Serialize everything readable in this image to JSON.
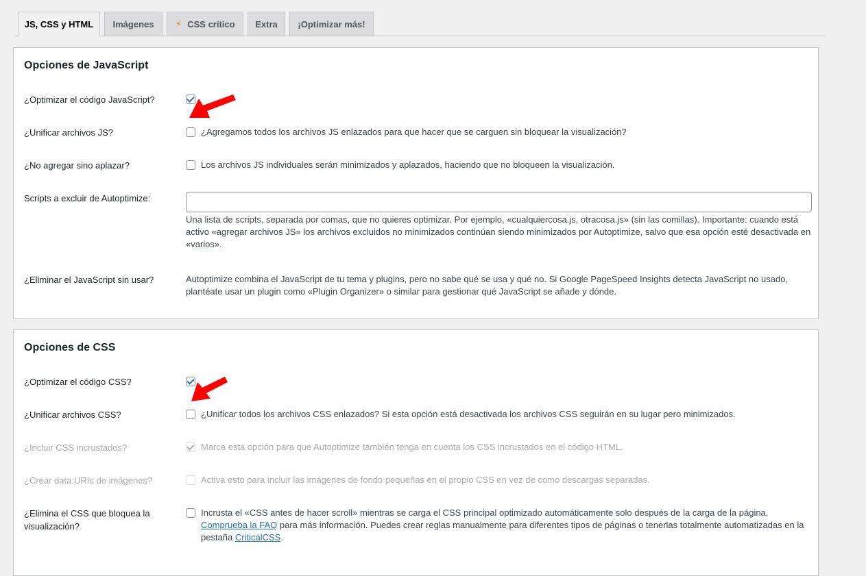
{
  "tabs": [
    {
      "label": "JS, CSS y HTML",
      "active": true
    },
    {
      "label": "Imágenes",
      "active": false
    },
    {
      "label": "CSS crítico",
      "active": false,
      "icon": "bolt-icon"
    },
    {
      "label": "Extra",
      "active": false
    },
    {
      "label": "¡Optimizar más!",
      "active": false
    }
  ],
  "js": {
    "title": "Opciones de JavaScript",
    "optimize": {
      "label": "¿Optimizar el código JavaScript?",
      "checked": true
    },
    "aggregate": {
      "label": "¿Unificar archivos JS?",
      "checked": false,
      "text": "¿Agregamos todos los archivos JS enlazados para que hacer que se carguen sin bloquear la visualización?"
    },
    "defer": {
      "label": "¿No agregar sino aplazar?",
      "checked": false,
      "text": "Los archivos JS individuales serán minimizados y aplazados, haciendo que no bloqueen la visualización."
    },
    "exclude": {
      "label": "Scripts a excluir de Autoptimize:",
      "value": "",
      "description": "Una lista de scripts, separada por comas, que no quieres optimizar. Por ejemplo, «cualquiercosa.js, otracosa.js» (sin las comillas). Importante: cuando está activo «agregar archivos JS» los archivos excluidos no minimizados continúan siendo minimizados por Autoptimize, salvo que esa opción esté desactivada en «varios»."
    },
    "unused": {
      "label": "¿Eliminar el JavaScript sin usar?",
      "text": "Autoptimize combina el JavaScript de tu tema y plugins, pero no sabe qué se usa y qué no. Si Google PageSpeed Insights detecta JavaScript no usado, plantéate usar un plugin como «Plugin Organizer» o similar para gestionar qué JavaScript se añade y dónde."
    }
  },
  "css": {
    "title": "Opciones de CSS",
    "optimize": {
      "label": "¿Optimizar el código CSS?",
      "checked": true
    },
    "aggregate": {
      "label": "¿Unificar archivos CSS?",
      "checked": false,
      "text": "¿Unificar todos los archivos CSS enlazados? Si esta opción está desactivada los archivos CSS seguirán en su lugar pero minimizados."
    },
    "inline": {
      "label": "¿Incluir CSS incrustados?",
      "checked": true,
      "text": "Marca esta opción para que Autoptimize también tenga en cuenta los CSS incrustados en el código HTML."
    },
    "datauri": {
      "label": "¿Crear data:URIs de imágenes?",
      "checked": false,
      "text": "Activa esto para incluir las imágenes de fondo pequeñas en el propio CSS en vez de como descargas separadas."
    },
    "defer": {
      "label": "¿Elimina el CSS que bloquea la visualización?",
      "checked": false,
      "text1": "Incrusta el «CSS antes de hacer scroll» mientras se carga el CSS principal optimizado automáticamente solo después de la carga de la página.",
      "faq_link": "Comprueba la FAQ",
      "text2": " para más información. Puedes crear reglas manualmente para diferentes tipos de páginas o tenerlas totalmente automatizadas en la pestaña ",
      "criticalcss_link": "CriticalCSS",
      "text3": "."
    }
  },
  "colors": {
    "arrow": "#ff0000",
    "accent": "#2271b1",
    "bolt": "#f0821e"
  }
}
